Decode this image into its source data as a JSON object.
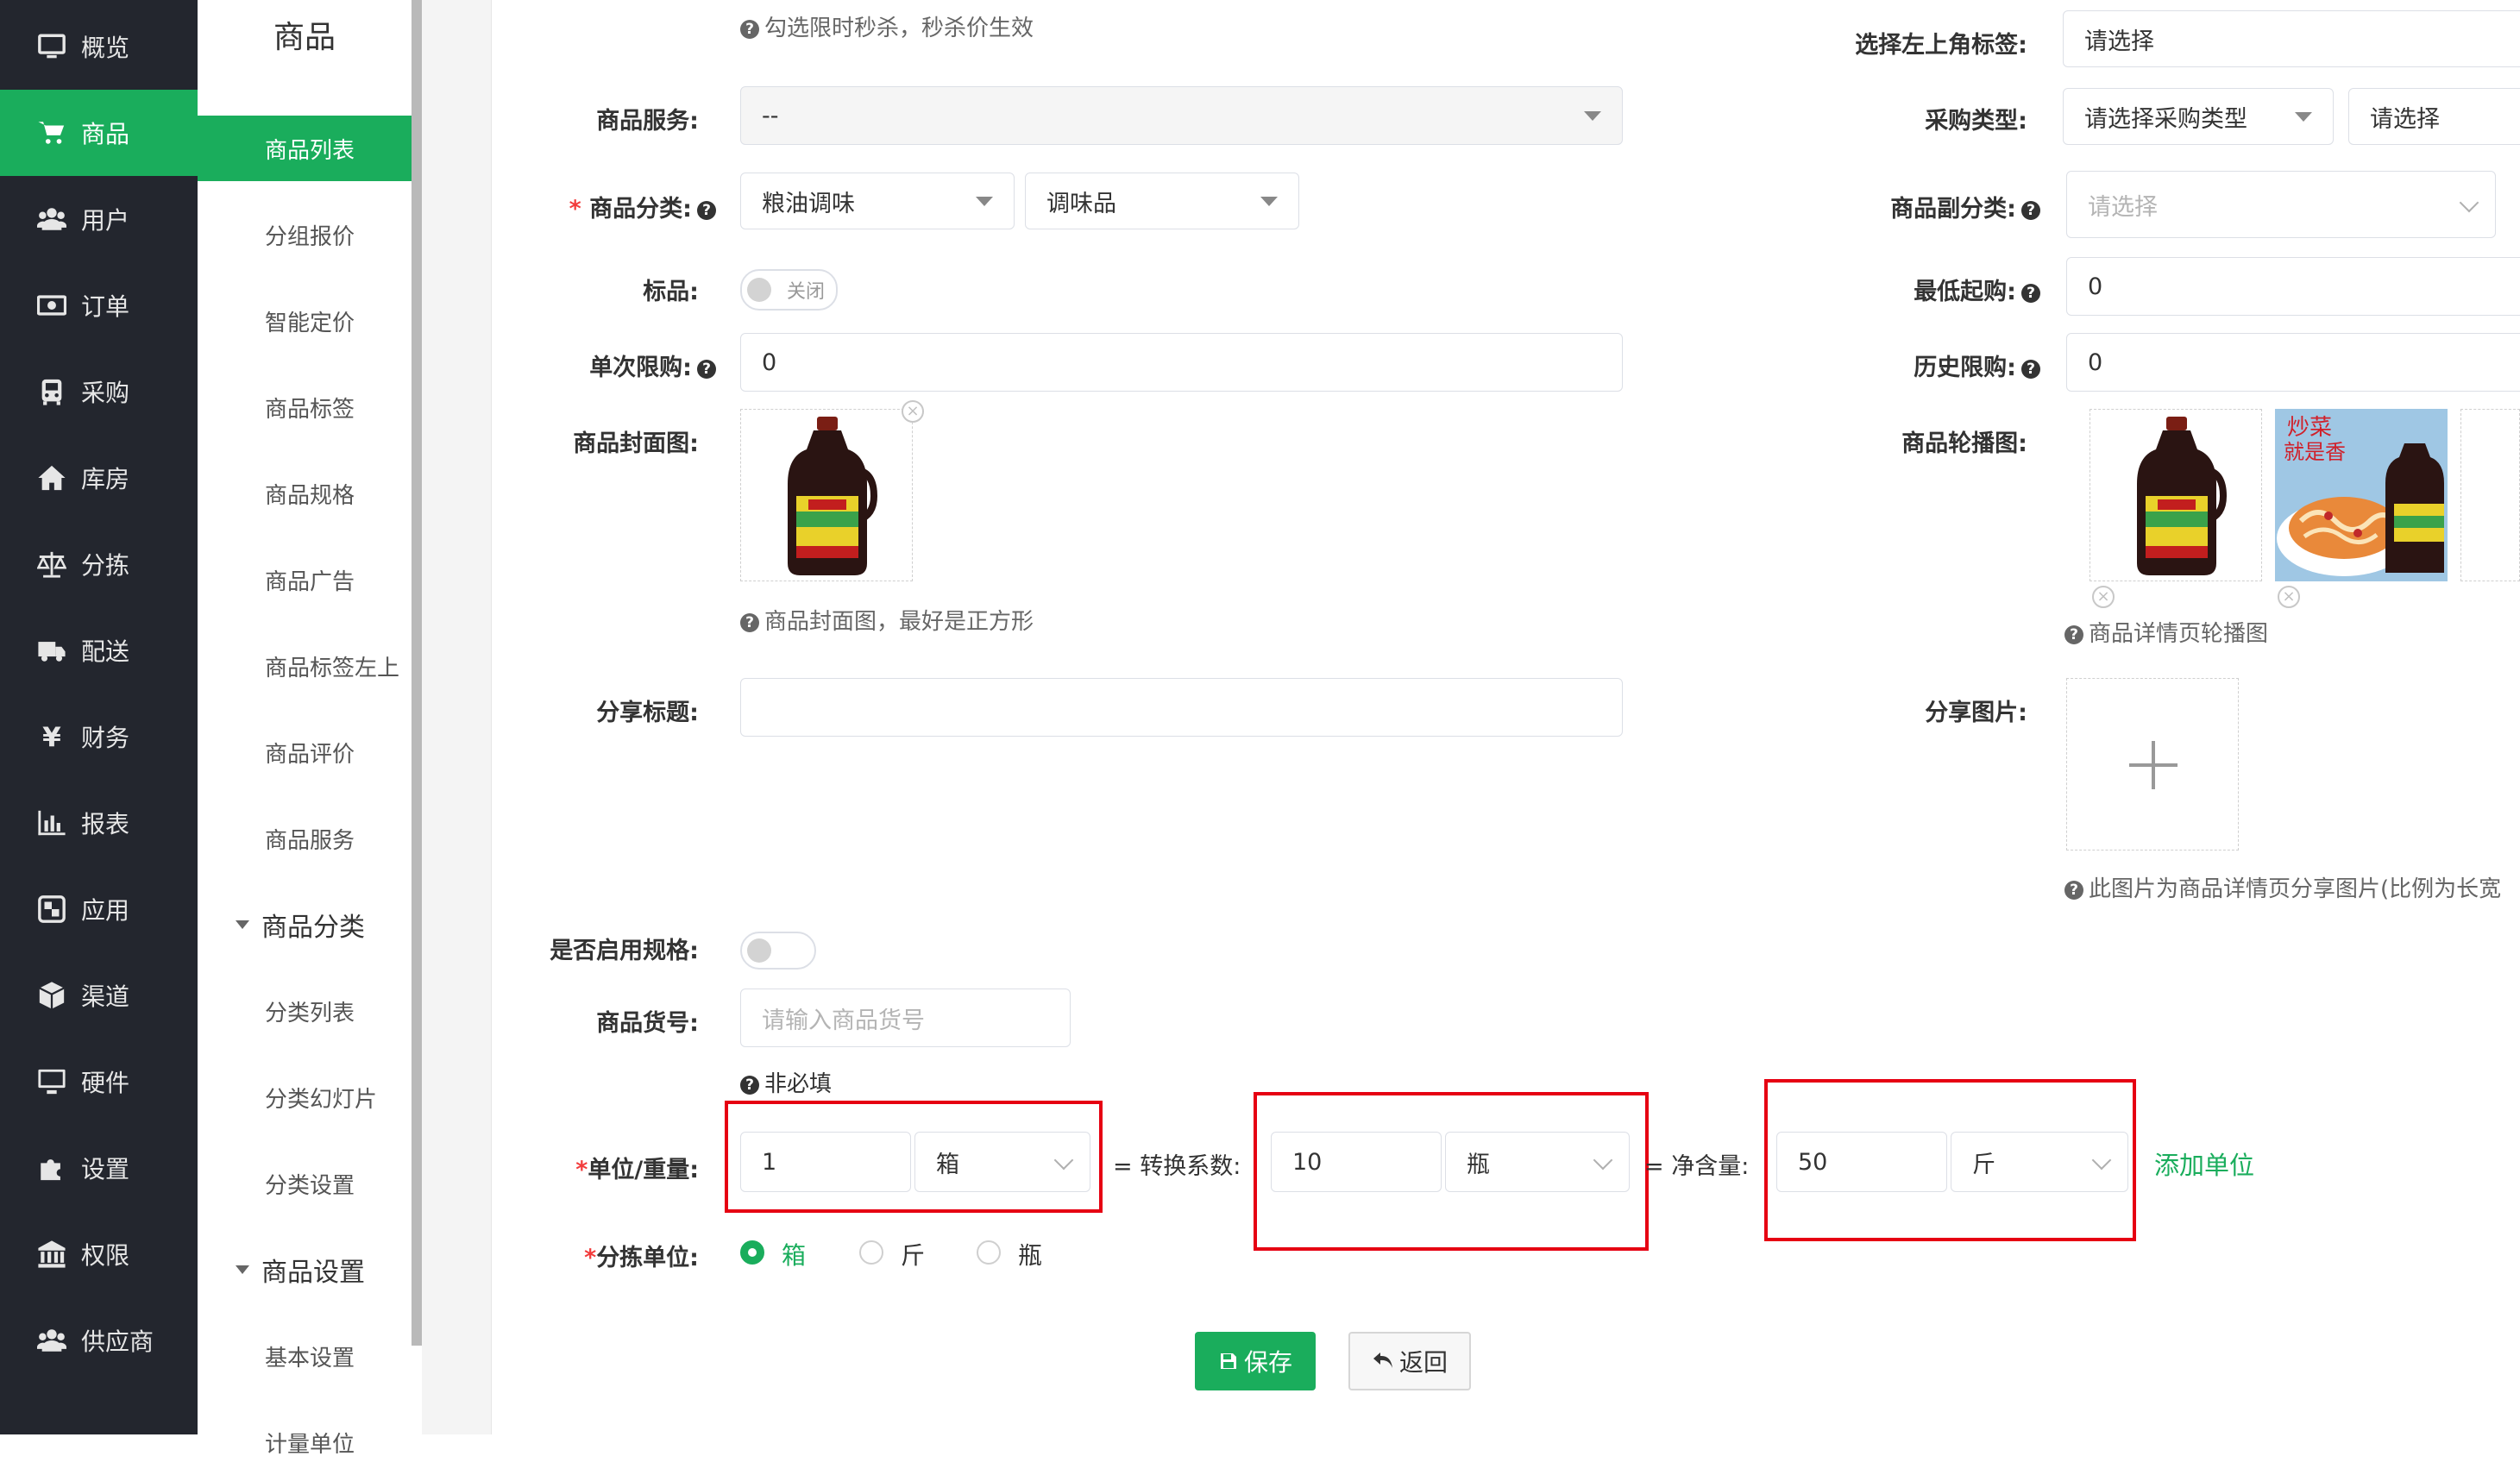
{
  "nav": {
    "items": [
      {
        "label": "概览",
        "icon": "monitor-icon"
      },
      {
        "label": "商品",
        "icon": "cart-icon"
      },
      {
        "label": "用户",
        "icon": "users-icon"
      },
      {
        "label": "订单",
        "icon": "money-icon"
      },
      {
        "label": "采购",
        "icon": "bus-icon"
      },
      {
        "label": "库房",
        "icon": "home-icon"
      },
      {
        "label": "分拣",
        "icon": "scale-icon"
      },
      {
        "label": "配送",
        "icon": "truck-icon"
      },
      {
        "label": "财务",
        "icon": "yen-icon"
      },
      {
        "label": "报表",
        "icon": "bar-chart-icon"
      },
      {
        "label": "应用",
        "icon": "apps-icon"
      },
      {
        "label": "渠道",
        "icon": "cube-icon"
      },
      {
        "label": "硬件",
        "icon": "desktop-icon"
      },
      {
        "label": "设置",
        "icon": "puzzle-icon"
      },
      {
        "label": "权限",
        "icon": "bank-icon"
      },
      {
        "label": "供应商",
        "icon": "supplier-icon"
      }
    ],
    "active": "商品"
  },
  "subnav": {
    "title": "商品",
    "items": [
      "商品列表",
      "分组报价",
      "智能定价",
      "商品标签",
      "商品规格",
      "商品广告",
      "商品标签左上",
      "商品评价",
      "商品服务"
    ],
    "group1": "商品分类",
    "group1_items": [
      "分类列表",
      "分类幻灯片",
      "分类设置"
    ],
    "group2": "商品设置",
    "group2_items": [
      "基本设置",
      "计量单位"
    ]
  },
  "form": {
    "flash_hint": "勾选限时秒杀，秒杀价生效",
    "corner_tag_label": "选择左上角标签:",
    "corner_tag_value": "请选择",
    "service_label": "商品服务:",
    "service_value": "--",
    "purchase_type_label": "采购类型:",
    "purchase_type_value": "请选择采购类型",
    "purchase_sub_value": "请选择",
    "category_label": "商品分类:",
    "category_1": "粮油调味",
    "category_2": "调味品",
    "sub_category_label": "商品副分类:",
    "sub_category_placeholder": "请选择",
    "standard_label": "标品:",
    "standard_state": "关闭",
    "min_order_label": "最低起购:",
    "min_order_value": "0",
    "single_limit_label": "单次限购:",
    "single_limit_value": "0",
    "history_limit_label": "历史限购:",
    "history_limit_value": "0",
    "cover_label": "商品封面图:",
    "cover_hint": "商品封面图，最好是正方形",
    "carousel_label": "商品轮播图:",
    "carousel_hint": "商品详情页轮播图",
    "carousel_caption_line1": "炒菜",
    "carousel_caption_line2": "就是香",
    "share_title_label": "分享标题:",
    "share_image_label": "分享图片:",
    "share_image_hint": "此图片为商品详情页分享图片(比例为长宽",
    "spec_label": "是否启用规格:",
    "sku_label": "商品货号:",
    "sku_placeholder": "请输入商品货号",
    "sku_hint": "非必填",
    "unit_label": "单位/重量:",
    "unit_qty": "1",
    "unit_name": "箱",
    "conv_label": "= 转换系数:",
    "conv_qty": "10",
    "conv_unit": "瓶",
    "net_label": "= 净含量:",
    "net_qty": "50",
    "net_unit": "斤",
    "add_unit": "添加单位",
    "pick_unit_label": "分拣单位:",
    "pick_options": [
      "箱",
      "斤",
      "瓶"
    ],
    "pick_selected": "箱",
    "save": "保存",
    "back": "返回"
  },
  "colors": {
    "brand_green": "#1aad5c",
    "nav_bg": "#23262e",
    "highlight_red": "#e60012"
  }
}
